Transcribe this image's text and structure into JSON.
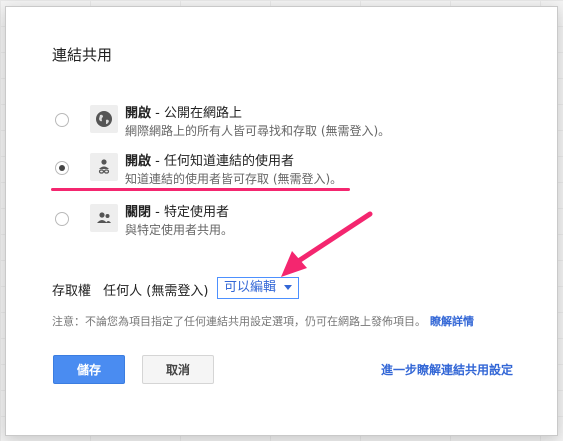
{
  "dialog": {
    "title": "連結共用",
    "options": [
      {
        "title": "開啟",
        "subtitle": " - 公開在網路上",
        "description": "網際網路上的所有人皆可尋找和存取 (無需登入)。",
        "icon": "globe-icon",
        "selected": false
      },
      {
        "title": "開啟",
        "subtitle": " - 任何知道連結的使用者",
        "description": "知道連結的使用者皆可存取 (無需登入)。",
        "icon": "link-person-icon",
        "selected": true
      },
      {
        "title": "關閉",
        "subtitle": " - 特定使用者",
        "description": "與特定使用者共用。",
        "icon": "people-icon",
        "selected": false
      }
    ],
    "access": {
      "label": "存取權",
      "who": "任何人 (無需登入)",
      "level": "可以編輯"
    },
    "note": "注意：不論您為項目指定了任何連結共用設定選項，仍可在網路上發佈項目。",
    "note_link": "瞭解詳情",
    "buttons": {
      "save": "儲存",
      "cancel": "取消"
    },
    "learn_more": "進一步瞭解連結共用設定"
  },
  "colors": {
    "accent": "#4a8cf1",
    "annotation": "#f4266f",
    "link": "#3367d6"
  }
}
